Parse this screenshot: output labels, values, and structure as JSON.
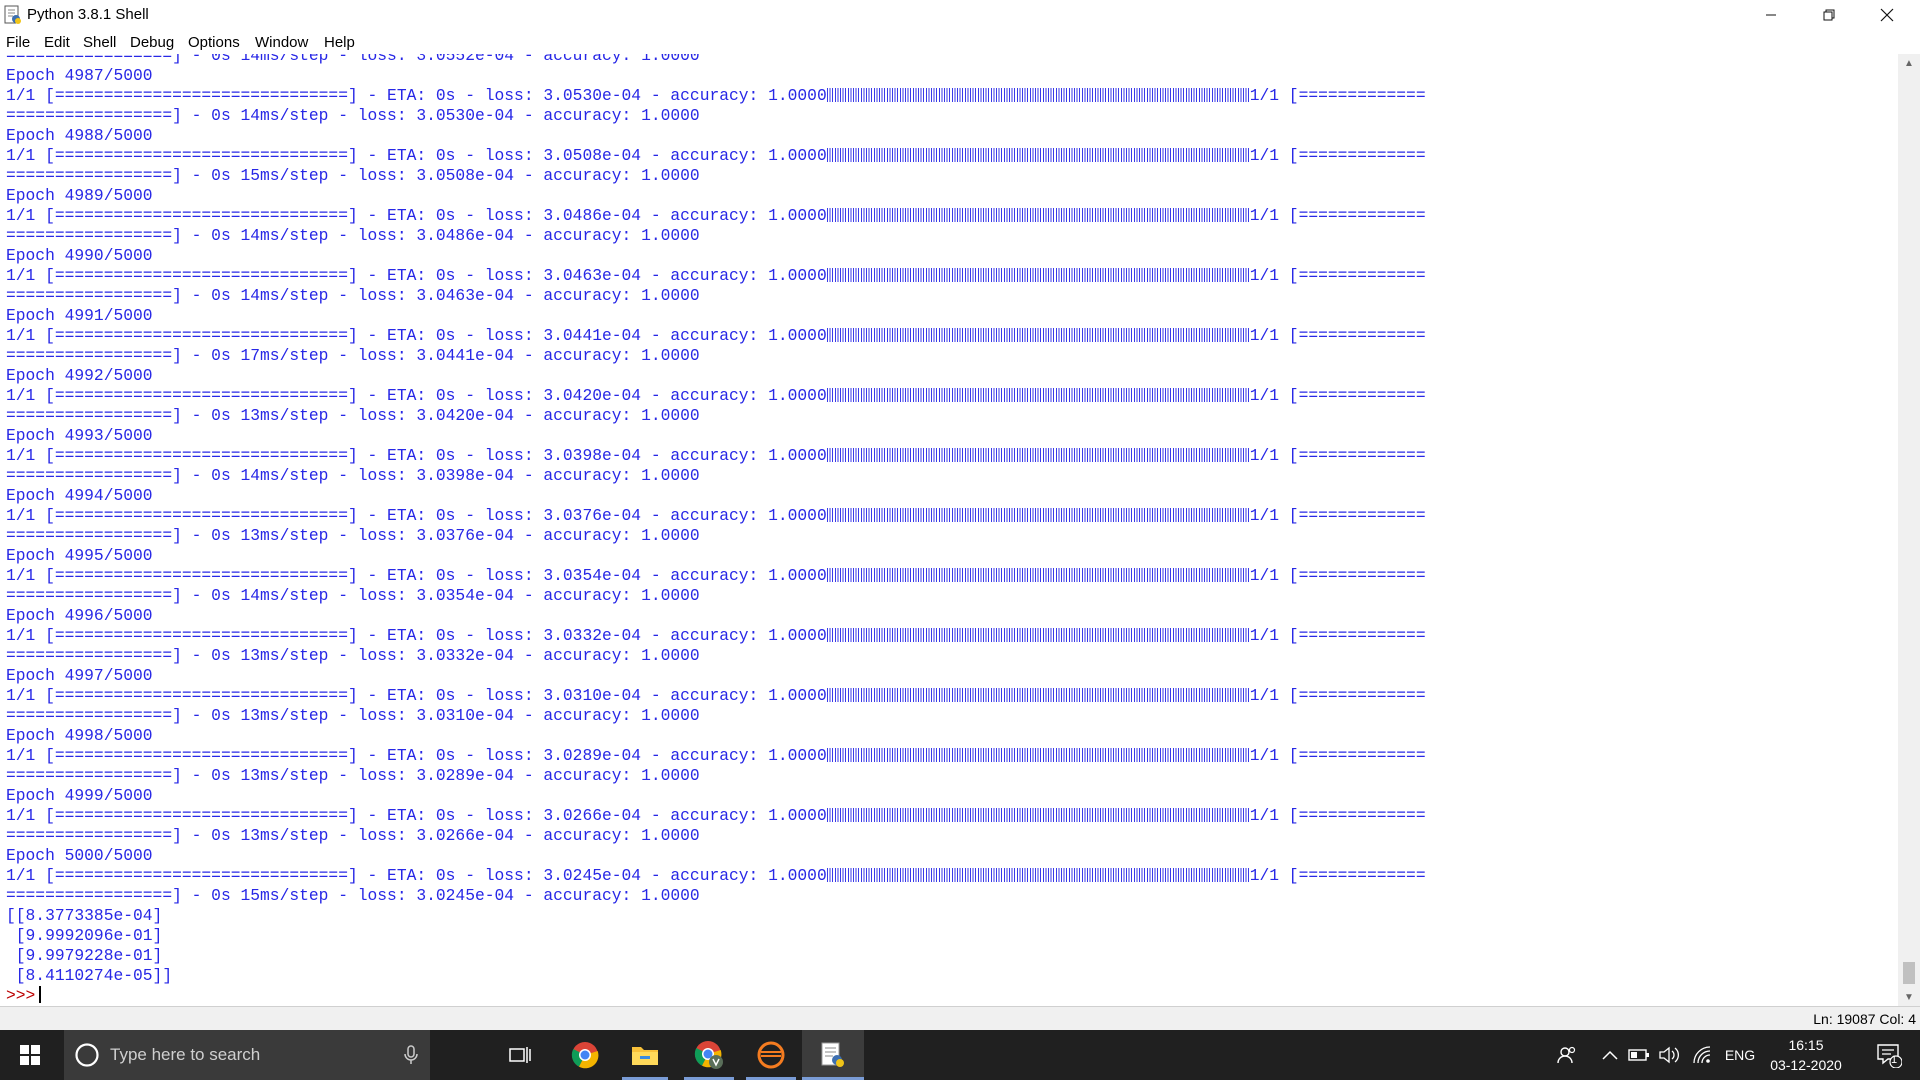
{
  "window": {
    "title": "Python 3.8.1 Shell",
    "controls": [
      "minimize-icon",
      "restore-icon",
      "close-icon"
    ]
  },
  "menu": [
    "File",
    "Edit",
    "Shell",
    "Debug",
    "Options",
    "Window",
    "Help"
  ],
  "shell": {
    "top_partial": "=================] - 0s 14ms/step - loss: 3.0552e-04 - accuracy: 1.0000",
    "epochs": [
      {
        "epoch": "Epoch 4987/5000",
        "eta_line": "1/1 [==============================] - ETA: 0s - loss: 3.0530e-04 - accuracy: 1.0000",
        "tail": "1/1 [=============",
        "step_line": "=================] - 0s 14ms/step - loss: 3.0530e-04 - accuracy: 1.0000"
      },
      {
        "epoch": "Epoch 4988/5000",
        "eta_line": "1/1 [==============================] - ETA: 0s - loss: 3.0508e-04 - accuracy: 1.0000",
        "tail": "1/1 [=============",
        "step_line": "=================] - 0s 15ms/step - loss: 3.0508e-04 - accuracy: 1.0000"
      },
      {
        "epoch": "Epoch 4989/5000",
        "eta_line": "1/1 [==============================] - ETA: 0s - loss: 3.0486e-04 - accuracy: 1.0000",
        "tail": "1/1 [=============",
        "step_line": "=================] - 0s 14ms/step - loss: 3.0486e-04 - accuracy: 1.0000"
      },
      {
        "epoch": "Epoch 4990/5000",
        "eta_line": "1/1 [==============================] - ETA: 0s - loss: 3.0463e-04 - accuracy: 1.0000",
        "tail": "1/1 [=============",
        "step_line": "=================] - 0s 14ms/step - loss: 3.0463e-04 - accuracy: 1.0000"
      },
      {
        "epoch": "Epoch 4991/5000",
        "eta_line": "1/1 [==============================] - ETA: 0s - loss: 3.0441e-04 - accuracy: 1.0000",
        "tail": "1/1 [=============",
        "step_line": "=================] - 0s 17ms/step - loss: 3.0441e-04 - accuracy: 1.0000"
      },
      {
        "epoch": "Epoch 4992/5000",
        "eta_line": "1/1 [==============================] - ETA: 0s - loss: 3.0420e-04 - accuracy: 1.0000",
        "tail": "1/1 [=============",
        "step_line": "=================] - 0s 13ms/step - loss: 3.0420e-04 - accuracy: 1.0000"
      },
      {
        "epoch": "Epoch 4993/5000",
        "eta_line": "1/1 [==============================] - ETA: 0s - loss: 3.0398e-04 - accuracy: 1.0000",
        "tail": "1/1 [=============",
        "step_line": "=================] - 0s 14ms/step - loss: 3.0398e-04 - accuracy: 1.0000"
      },
      {
        "epoch": "Epoch 4994/5000",
        "eta_line": "1/1 [==============================] - ETA: 0s - loss: 3.0376e-04 - accuracy: 1.0000",
        "tail": "1/1 [=============",
        "step_line": "=================] - 0s 13ms/step - loss: 3.0376e-04 - accuracy: 1.0000"
      },
      {
        "epoch": "Epoch 4995/5000",
        "eta_line": "1/1 [==============================] - ETA: 0s - loss: 3.0354e-04 - accuracy: 1.0000",
        "tail": "1/1 [=============",
        "step_line": "=================] - 0s 14ms/step - loss: 3.0354e-04 - accuracy: 1.0000"
      },
      {
        "epoch": "Epoch 4996/5000",
        "eta_line": "1/1 [==============================] - ETA: 0s - loss: 3.0332e-04 - accuracy: 1.0000",
        "tail": "1/1 [=============",
        "step_line": "=================] - 0s 13ms/step - loss: 3.0332e-04 - accuracy: 1.0000"
      },
      {
        "epoch": "Epoch 4997/5000",
        "eta_line": "1/1 [==============================] - ETA: 0s - loss: 3.0310e-04 - accuracy: 1.0000",
        "tail": "1/1 [=============",
        "step_line": "=================] - 0s 13ms/step - loss: 3.0310e-04 - accuracy: 1.0000"
      },
      {
        "epoch": "Epoch 4998/5000",
        "eta_line": "1/1 [==============================] - ETA: 0s - loss: 3.0289e-04 - accuracy: 1.0000",
        "tail": "1/1 [=============",
        "step_line": "=================] - 0s 13ms/step - loss: 3.0289e-04 - accuracy: 1.0000"
      },
      {
        "epoch": "Epoch 4999/5000",
        "eta_line": "1/1 [==============================] - ETA: 0s - loss: 3.0266e-04 - accuracy: 1.0000",
        "tail": "1/1 [=============",
        "step_line": "=================] - 0s 13ms/step - loss: 3.0266e-04 - accuracy: 1.0000"
      },
      {
        "epoch": "Epoch 5000/5000",
        "eta_line": "1/1 [==============================] - ETA: 0s - loss: 3.0245e-04 - accuracy: 1.0000",
        "tail": "1/1 [=============",
        "step_line": "=================] - 0s 15ms/step - loss: 3.0245e-04 - accuracy: 1.0000"
      }
    ],
    "result": [
      "[[8.3773385e-04]",
      " [9.9992096e-01]",
      " [9.9979228e-01]",
      " [8.4110274e-05]]"
    ],
    "prompt": ">>>",
    "text_color": "#2727e6"
  },
  "status": {
    "position": "Ln: 19087   Col: 4"
  },
  "taskbar": {
    "search_placeholder": "Type here to search",
    "language": "ENG",
    "time": "16:15",
    "date": "03-12-2020",
    "notification_count": "1",
    "accent": "#7a9cd6"
  }
}
